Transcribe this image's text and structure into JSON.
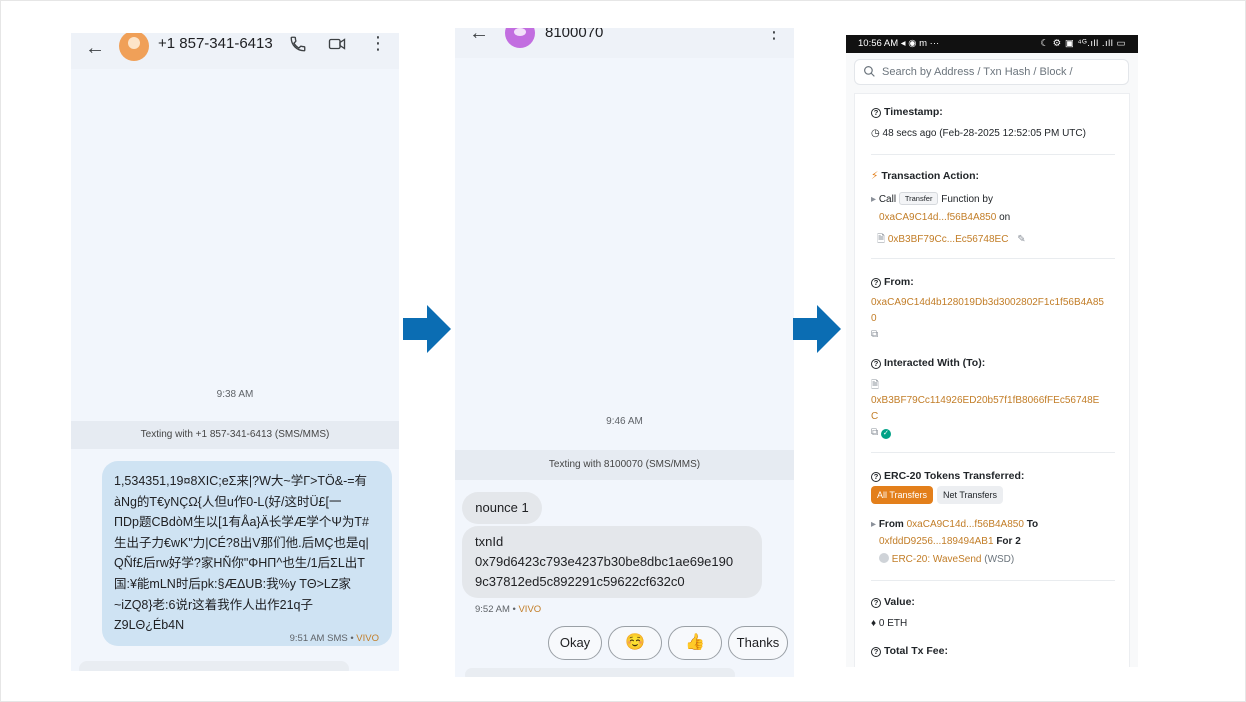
{
  "phone1": {
    "contact_name": "+1 857-341-6413",
    "time_label": "9:38 AM",
    "texting_label": "Texting with +1 857-341-6413 (SMS/MMS)",
    "message_lines": [
      "1,534351,19¤8XIC;eΣ来|?W大~学Γ>TÖ&-=有",
      "àNg的T€yNÇΩ{人但u作0-L(好/这时Ü£[一",
      "ΠDp题CBdòM生以[1有Åa}Ä长学Æ学个Ψ为T#",
      "生出子力€wK\"力|CÉ?8出V那们他.后MÇ也是q|",
      "QÑf£后rw好学?家HÑ你\"ΦHΠ^也生/1后ΣL出T",
      "国:¥能mLN时后pk:§ÆΔUB:我%y TΘ>LZ家",
      "~iZQ8}老:6说r这着我作人出作21q子",
      "Z9LΘ¿Éb4N"
    ],
    "message_meta": "9:51 AM SMS •",
    "message_sim": "VIVO"
  },
  "phone2": {
    "contact_name": "8100070",
    "time_label": "9:46 AM",
    "texting_label": "Texting with 8100070 (SMS/MMS)",
    "msg1": "nounce 1",
    "msg2_lines": [
      "txnId",
      "0x79d6423c793e4237b30be8dbc1ae69e190",
      "9c37812ed5c892291c59622cf632c0"
    ],
    "msg_meta": "9:52 AM •",
    "msg_sim": "VIVO",
    "chips": [
      "Okay",
      "☺️",
      "👍",
      "Thanks"
    ]
  },
  "explorer": {
    "status_time": "10:56 AM",
    "status_icons_left": "◂ ◉ m ···",
    "status_icons_right": "☾ ⚙ ▣ ⁴ᴳ.ıll .ıll ▭",
    "search_placeholder": "Search by Address / Txn Hash / Block /",
    "timestamp_label": "Timestamp:",
    "timestamp_value": "48 secs ago (Feb-28-2025 12:52:05 PM UTC)",
    "action_label": "Transaction Action:",
    "action_call": "Call",
    "action_method": "Transfer",
    "action_by": "Function by",
    "action_from": "0xaCA9C14d...f56B4A850",
    "action_on": "on",
    "action_contract": "0xB3BF79Cc...Ec56748EC",
    "from_label": "From:",
    "from_line1": "0xaCA9C14d4b128019Db3d3002802F1c1f56B4A85",
    "from_line2": "0",
    "to_label": "Interacted With (To):",
    "to_line1": "0xB3BF79Cc114926ED20b57f1fB8066fFEc56748E",
    "to_line2": "C",
    "erc_label": "ERC-20 Tokens Transferred:",
    "btn_all": "All Transfers",
    "btn_net": "Net Transfers",
    "tr_from_word": "From",
    "tr_from": "0xaCA9C14d...f56B4A850",
    "tr_to_word": "To",
    "tr_to": "0xfddD9256...189494AB1",
    "tr_for": "For 2",
    "token_name": "ERC-20: WaveSend",
    "token_symbol": "(WSD)",
    "value_label": "Value:",
    "value": "0 ETH",
    "fee_label": "Total Tx Fee:"
  },
  "colors": {
    "arrow": "#0b6db3",
    "link": "#c27d27",
    "button": "#e37f1b"
  }
}
